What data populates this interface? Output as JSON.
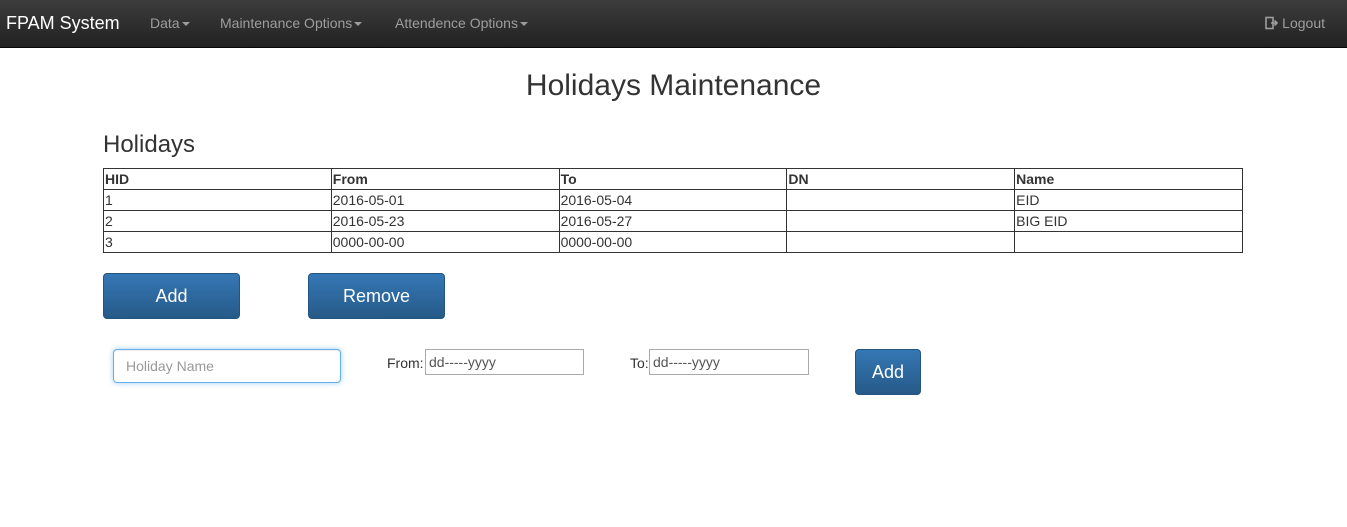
{
  "navbar": {
    "brand": "FPAM System",
    "menus": [
      "Data",
      "Maintenance Options",
      "Attendence Options"
    ],
    "logout": "Logout"
  },
  "page": {
    "title": "Holidays Maintenance",
    "section_title": "Holidays"
  },
  "table": {
    "headers": [
      "HID",
      "From",
      "To",
      "DN",
      "Name"
    ],
    "rows": [
      [
        "1",
        "2016-05-01",
        "2016-05-04",
        "",
        "EID"
      ],
      [
        "2",
        "2016-05-23",
        "2016-05-27",
        "",
        "BIG EID"
      ],
      [
        "3",
        "0000-00-00",
        "0000-00-00",
        "",
        ""
      ]
    ]
  },
  "actions": {
    "add_label": "Add",
    "remove_label": "Remove"
  },
  "form": {
    "name_placeholder": "Holiday Name",
    "from_label": "From:",
    "from_value": "dd-----yyyy",
    "to_label": "To:",
    "to_value": "dd-----yyyy",
    "submit_label": "Add"
  }
}
